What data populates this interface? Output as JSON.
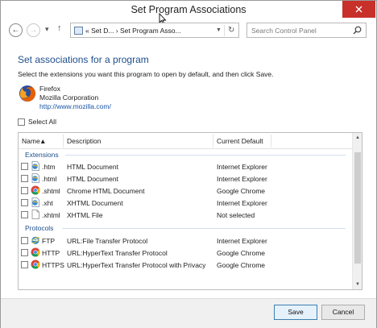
{
  "window": {
    "title": "Set Program Associations"
  },
  "nav": {
    "breadcrumb": "« Set D...  ›  Set Program Asso...",
    "search_placeholder": "Search Control Panel"
  },
  "heading": "Set associations for a program",
  "instruction": "Select the extensions you want this program to open by default, and then click Save.",
  "program": {
    "name": "Firefox",
    "company": "Mozilla Corporation",
    "url": "http://www.mozilla.com/"
  },
  "select_all_label": "Select All",
  "columns": {
    "name": "Name",
    "description": "Description",
    "current_default": "Current Default"
  },
  "groups": {
    "extensions": {
      "label": "Extensions",
      "items": [
        {
          "ext": ".htm",
          "desc": "HTML Document",
          "default": "Internet Explorer",
          "icon": "html-file-icon"
        },
        {
          "ext": ".html",
          "desc": "HTML Document",
          "default": "Internet Explorer",
          "icon": "html-file-icon"
        },
        {
          "ext": ".shtml",
          "desc": "Chrome HTML Document",
          "default": "Google Chrome",
          "icon": "chrome-icon"
        },
        {
          "ext": ".xht",
          "desc": "XHTML Document",
          "default": "Internet Explorer",
          "icon": "html-file-icon"
        },
        {
          "ext": ".xhtml",
          "desc": "XHTML File",
          "default": "Not selected",
          "icon": "generic-file-icon"
        }
      ]
    },
    "protocols": {
      "label": "Protocols",
      "items": [
        {
          "ext": "FTP",
          "desc": "URL:File Transfer Protocol",
          "default": "Internet Explorer",
          "icon": "ie-icon"
        },
        {
          "ext": "HTTP",
          "desc": "URL:HyperText Transfer Protocol",
          "default": "Google Chrome",
          "icon": "chrome-icon"
        },
        {
          "ext": "HTTPS",
          "desc": "URL:HyperText Transfer Protocol with Privacy",
          "default": "Google Chrome",
          "icon": "chrome-icon"
        }
      ]
    }
  },
  "buttons": {
    "save": "Save",
    "cancel": "Cancel"
  },
  "colors": {
    "accent": "#1e4e8c",
    "close": "#c7312a",
    "link": "#1a55a8"
  }
}
